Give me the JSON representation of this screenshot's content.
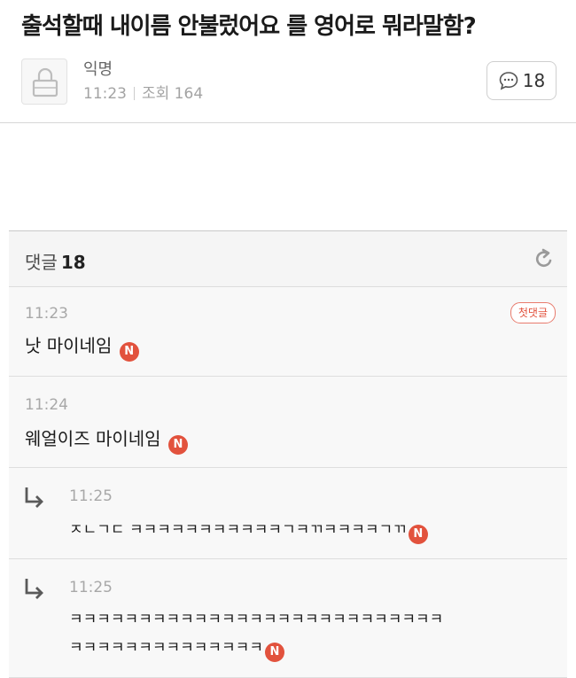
{
  "post": {
    "title": "출석할때 내이름 안불렀어요 를 영어로 뭐라말함?",
    "author": "익명",
    "time": "11:23",
    "views_label": "조회 164",
    "comment_count": "18"
  },
  "comments_header": {
    "label": "댓글",
    "count": "18"
  },
  "comments": [
    {
      "time": "11:23",
      "text": "낫 마이네임",
      "badge": "첫댓글",
      "new_mark": "N",
      "is_reply": false
    },
    {
      "time": "11:24",
      "text": "웨얼이즈 마이네임",
      "new_mark": "N",
      "is_reply": false
    },
    {
      "time": "11:25",
      "text": "ㅈㄴㄱㄷ ㅋㅋㅋㅋㅋㅋㅋㅋㅋㅋㅋㄱㅋㄲㅋㅋㅋㅋㄱㄲ",
      "new_mark": "N",
      "is_reply": true
    },
    {
      "time": "11:25",
      "text_line1": "ㅋㅋㅋㅋㅋㅋㅋㅋㅋㅋㅋㅋㅋㅋㅋㅋㅋㅋㅋㅋㅋㅋㅋㅋㅋㅋㅋ",
      "text_line2": "ㅋㅋㅋㅋㅋㅋㅋㅋㅋㅋㅋㅋㅋㅋ",
      "new_mark": "N",
      "is_reply": true
    }
  ],
  "icons": {
    "avatar": "lock-icon",
    "comment": "speech-bubble-icon",
    "refresh": "refresh-icon",
    "reply": "reply-arrow-icon"
  },
  "colors": {
    "accent": "#e2523d",
    "header_bg": "#f5f5f5",
    "comment_bg": "#f8f8f8"
  }
}
